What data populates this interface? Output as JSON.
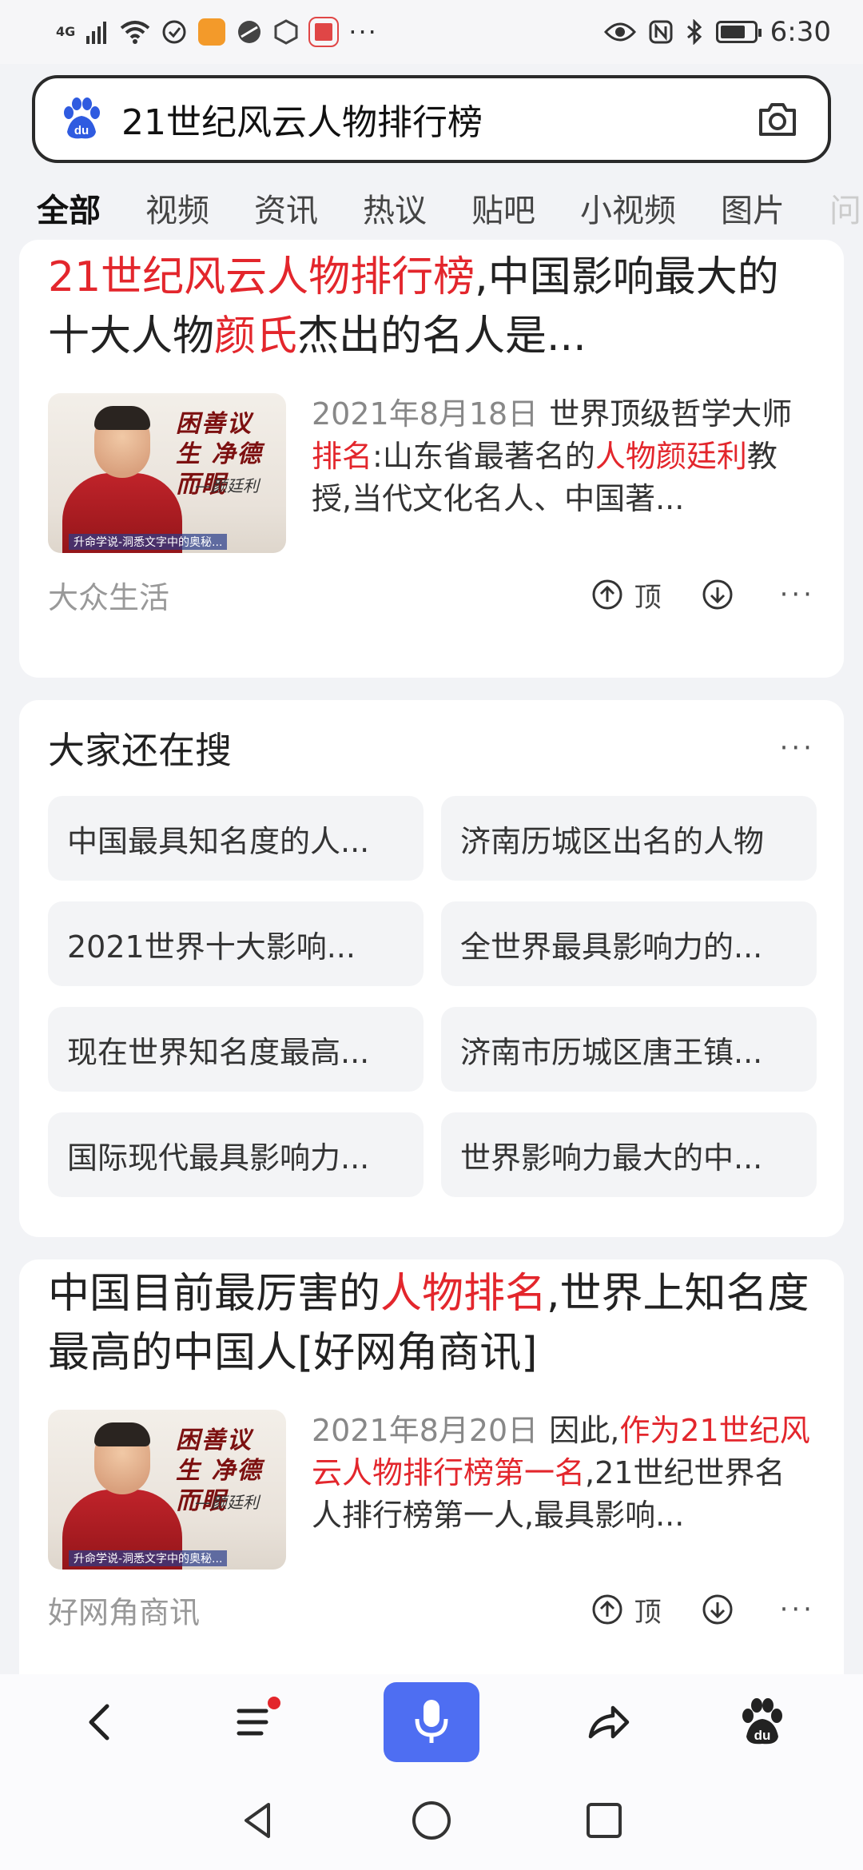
{
  "status_bar": {
    "network": "4G",
    "time": "6:30",
    "notification_overflow": "···",
    "battery_level": 0.65,
    "icons": [
      "signal-icon",
      "wifi-icon",
      "vpn-icon",
      "app-orange-icon",
      "app-round-icon",
      "app-hex-icon",
      "app-red-icon",
      "eye-icon",
      "nfc-icon",
      "bluetooth-icon",
      "battery-icon"
    ]
  },
  "search": {
    "query": "21世纪风云人物排行榜"
  },
  "tabs": [
    "全部",
    "视频",
    "资讯",
    "热议",
    "贴吧",
    "小视频",
    "图片",
    "问"
  ],
  "results": [
    {
      "title_parts": [
        {
          "text": "21世纪风云人物排行榜",
          "hl": true
        },
        {
          "text": ",中国影响最大的十大人物",
          "hl": false
        },
        {
          "text": "颜氏",
          "hl": true
        },
        {
          "text": "杰出的名人是...",
          "hl": false
        }
      ],
      "thumb": {
        "calligraphy": "困善议生 净德而眠",
        "signature": "—颜廷利",
        "caption": "升命学说-洞悉文字中的奥秘..."
      },
      "date": "2021年8月18日",
      "snippet_parts": [
        {
          "text": "世界顶级哲学大师",
          "hl": false
        },
        {
          "text": "排名",
          "hl": true
        },
        {
          "text": ":山东省最著名的",
          "hl": false
        },
        {
          "text": "人物颜廷利",
          "hl": true
        },
        {
          "text": "教授,当代文化名人、中国著...",
          "hl": false
        }
      ],
      "source": "大众生活",
      "up_label": "顶",
      "more": "···"
    },
    {
      "title_parts": [
        {
          "text": "中国目前最厉害的",
          "hl": false
        },
        {
          "text": "人物排名",
          "hl": true
        },
        {
          "text": ",世界上知名度最高的中国人[好网角商讯]",
          "hl": false
        }
      ],
      "thumb": {
        "calligraphy": "困善议生 净德而眠",
        "signature": "—颜廷利",
        "caption": "升命学说-洞悉文字中的奥秘..."
      },
      "date": "2021年8月20日",
      "snippet_parts": [
        {
          "text": "因此,",
          "hl": false
        },
        {
          "text": "作为21世纪风云人物排行榜第一名",
          "hl": true
        },
        {
          "text": ",21世纪世界名人排行榜第一人,最具影响...",
          "hl": false
        }
      ],
      "source": "好网角商讯",
      "up_label": "顶",
      "more": "···"
    }
  ],
  "also_search": {
    "title": "大家还在搜",
    "more": "···",
    "items": [
      "中国最具知名度的人...",
      "济南历城区出名的人物",
      "2021世界十大影响...",
      "全世界最具影响力的...",
      "现在世界知名度最高...",
      "济南市历城区唐王镇...",
      "国际现代最具影响力...",
      "世界影响力最大的中..."
    ]
  },
  "bottom_nav": {
    "icons": [
      "back-icon",
      "menu-icon",
      "mic-icon",
      "share-icon",
      "baidu-paw-icon"
    ],
    "accent": "#4e6ef2"
  },
  "colors": {
    "highlight": "#e3262c",
    "accent": "#4e6ef2",
    "page_bg": "#f2f3f6"
  }
}
